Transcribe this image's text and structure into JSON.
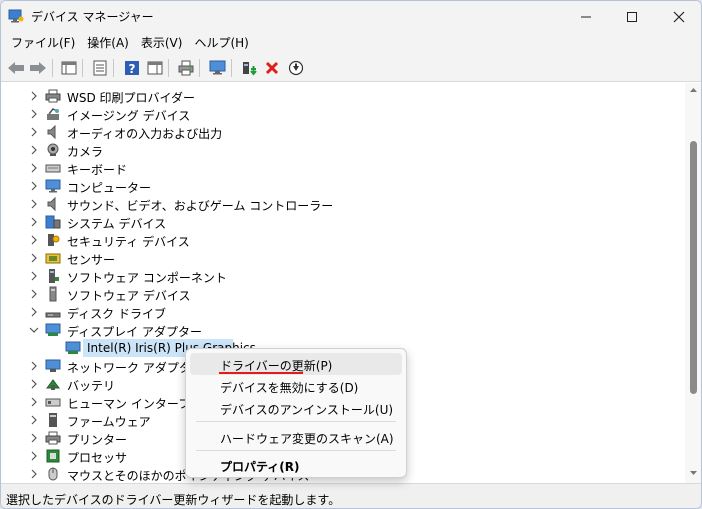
{
  "window": {
    "title": "デバイス マネージャー"
  },
  "menubar": {
    "items": [
      "ファイル(F)",
      "操作(A)",
      "表示(V)",
      "ヘルプ(H)"
    ]
  },
  "tree": {
    "items": [
      {
        "label": "WSD 印刷プロバイダー",
        "icon": "printer-icon"
      },
      {
        "label": "イメージング デバイス",
        "icon": "camera-device-icon"
      },
      {
        "label": "オーディオの入力および出力",
        "icon": "speaker-icon"
      },
      {
        "label": "カメラ",
        "icon": "webcam-icon"
      },
      {
        "label": "キーボード",
        "icon": "keyboard-icon"
      },
      {
        "label": "コンピューター",
        "icon": "monitor-icon"
      },
      {
        "label": "サウンド、ビデオ、およびゲーム コントローラー",
        "icon": "speaker-icon"
      },
      {
        "label": "システム デバイス",
        "icon": "system-device-icon"
      },
      {
        "label": "セキュリティ デバイス",
        "icon": "security-key-icon"
      },
      {
        "label": "センサー",
        "icon": "sensor-icon"
      },
      {
        "label": "ソフトウェア コンポーネント",
        "icon": "software-component-icon"
      },
      {
        "label": "ソフトウェア デバイス",
        "icon": "software-device-icon"
      },
      {
        "label": "ディスク ドライブ",
        "icon": "disk-drive-icon"
      },
      {
        "label": "ディスプレイ アダプター",
        "icon": "display-adapter-icon",
        "expanded": true
      },
      {
        "label": "Intel(R) Iris(R) Plus Graphics",
        "icon": "display-adapter-icon",
        "child": true,
        "selected": true
      },
      {
        "label": "ネットワーク アダプター",
        "icon": "network-adapter-icon"
      },
      {
        "label": "バッテリ",
        "icon": "battery-icon"
      },
      {
        "label": "ヒューマン インターフェイス デバイス",
        "icon": "hid-icon"
      },
      {
        "label": "ファームウェア",
        "icon": "firmware-icon"
      },
      {
        "label": "プリンター",
        "icon": "printer-icon"
      },
      {
        "label": "プロセッサ",
        "icon": "processor-icon"
      },
      {
        "label": "マウスとそのほかのポインティング デバイス",
        "icon": "mouse-icon"
      }
    ]
  },
  "context_menu": {
    "update_driver": "ドライバーの更新(P)",
    "disable_device": "デバイスを無効にする(D)",
    "uninstall_device": "デバイスのアンインストール(U)",
    "scan_hardware": "ハードウェア変更のスキャン(A)",
    "properties": "プロパティ(R)"
  },
  "statusbar": {
    "text": "選択したデバイスのドライバー更新ウィザードを起動します。"
  },
  "colors": {
    "accent": "#0067c0",
    "selection": "#cce4f7",
    "uninstall_red": "#e21b1b",
    "highlight_underline": "#e21b1b"
  }
}
